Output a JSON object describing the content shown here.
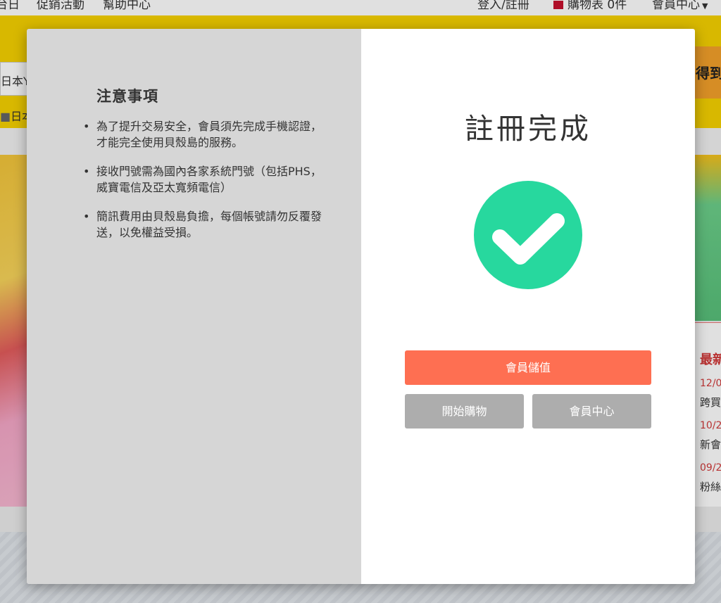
{
  "background": {
    "topnav": {
      "item_1": "台日",
      "item_2": "促銷活動",
      "item_3": "幫助中心",
      "login": "登入/註冊",
      "cart": "購物表 0件",
      "member": "會員中心"
    },
    "search_prefix": "日本Y",
    "sub_text": "日本",
    "right_cta": "得到",
    "news": {
      "title": "最新",
      "items": [
        {
          "date": "12/0",
          "text": "跨買"
        },
        {
          "date": "10/2",
          "text": "新會"
        },
        {
          "date": "09/2",
          "text": "粉絲"
        }
      ]
    }
  },
  "notice": {
    "title": "注意事項",
    "items": [
      "為了提升交易安全，會員須先完成手機認證，才能完全使用貝殼島的服務。",
      "接收門號需為國內各家系統門號（包括PHS，威寶電信及亞太寬頻電信）",
      "簡訊費用由貝殼島負擔，每個帳號請勿反覆發送，以免權益受損。"
    ]
  },
  "success": {
    "title": "註冊完成",
    "icon": "check-circle-icon",
    "icon_color": "#27d89e"
  },
  "actions": {
    "topup_label": "會員儲值",
    "shop_label": "開始購物",
    "member_label": "會員中心",
    "topup_color": "#fe6f52",
    "secondary_color": "#adadad"
  }
}
